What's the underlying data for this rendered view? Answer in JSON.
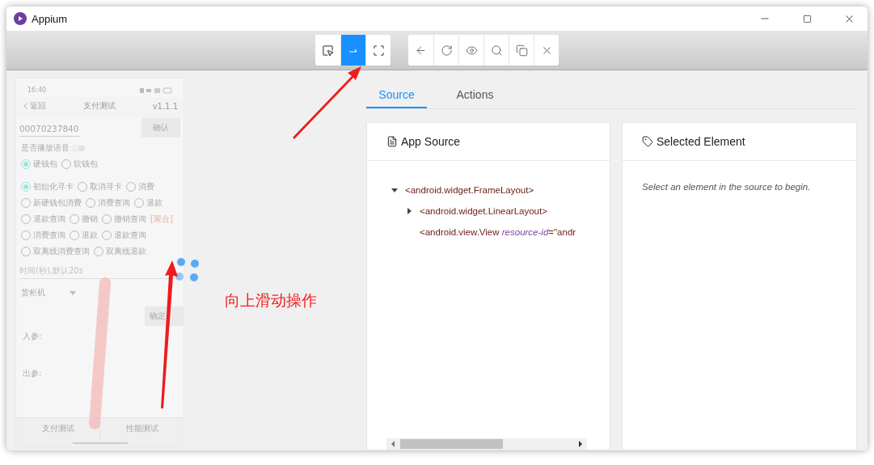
{
  "window": {
    "title": "Appium"
  },
  "toolbar": {
    "mode_buttons": [
      {
        "selected": false
      },
      {
        "selected": true
      },
      {
        "selected": false
      }
    ]
  },
  "device_screen": {
    "time": "16:40",
    "back": "返回",
    "title": "支付测试",
    "version": "v1.1.1",
    "input_value": "00070237840",
    "confirm": "确认",
    "voice_label": "是否播放语音",
    "voice_on": false,
    "wallets": [
      {
        "label": "硬钱包",
        "selected": true
      },
      {
        "label": "软钱包",
        "selected": false
      }
    ],
    "operation_rows": [
      {
        "options": [
          {
            "label": "初始化寻卡",
            "selected": true
          },
          {
            "label": "取消寻卡",
            "selected": false
          },
          {
            "label": "消费",
            "selected": false
          }
        ]
      },
      {
        "options": [
          {
            "label": "新硬钱包消费",
            "selected": false
          },
          {
            "label": "消费查询",
            "selected": false
          },
          {
            "label": "退款",
            "selected": false
          }
        ]
      },
      {
        "options": [
          {
            "label": "退款查询",
            "selected": false
          },
          {
            "label": "撤销",
            "selected": false
          },
          {
            "label": "撤销查询",
            "selected": false
          }
        ],
        "tag": "[聚合]"
      },
      {
        "options": [
          {
            "label": "消费查询",
            "selected": false
          },
          {
            "label": "退款",
            "selected": false
          },
          {
            "label": "退款查询",
            "selected": false
          }
        ]
      },
      {
        "options": [
          {
            "label": "双离线消费查询",
            "selected": false
          },
          {
            "label": "双离线退款",
            "selected": false
          }
        ]
      }
    ],
    "timeout_placeholder": "时间(秒),默认20s",
    "device_select": "货柜机",
    "submit": "确定",
    "input_label": "入参:",
    "output_label": "出参:",
    "bottom_tabs": [
      "支付测试",
      "性能测试"
    ]
  },
  "tabs": [
    {
      "label": "Source",
      "selected": true
    },
    {
      "label": "Actions",
      "selected": false
    }
  ],
  "app_source": {
    "title": "App Source",
    "tree": [
      {
        "tag": "<android.widget.FrameLayout>",
        "expanded": true,
        "children": [
          {
            "tag": "<android.widget.LinearLayout>",
            "expanded": false
          },
          {
            "tag": "<android.view.View",
            "attribute": "resource-id",
            "value": "=\"andr"
          }
        ]
      }
    ]
  },
  "selected_element": {
    "title": "Selected Element",
    "hint": "Select an element in the source to begin."
  },
  "annotation": {
    "text": "向上滑动操作"
  }
}
